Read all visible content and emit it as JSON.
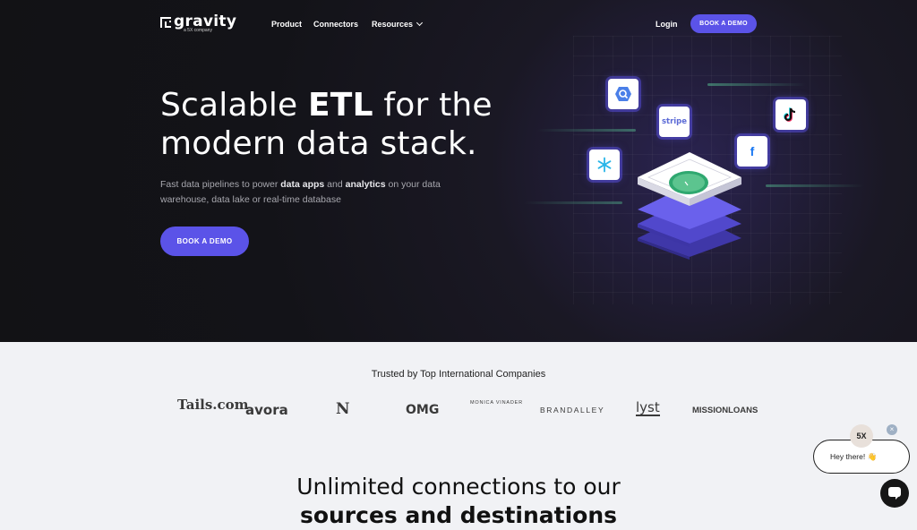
{
  "nav": {
    "logo_text": "gravity",
    "logo_sub": "a 5X company",
    "links": [
      "Product",
      "Connectors",
      "Resources"
    ],
    "login": "Login",
    "cta": "BOOK A DEMO"
  },
  "hero": {
    "headline_pre": "Scalable ",
    "headline_bold": "ETL",
    "headline_post": " for the",
    "headline_line2": "modern data stack.",
    "sub_1": "Fast data pipelines to power ",
    "sub_b1": "data apps",
    "sub_2": " and ",
    "sub_b2": "analytics",
    "sub_3": " on your data warehouse, data lake or real-time database",
    "cta": "BOOK A DEMO",
    "integrations": [
      "bigquery-icon",
      "stripe",
      "tiktok-icon",
      "snowflake-icon",
      "facebook-icon"
    ],
    "stripe_label": "stripe",
    "facebook_label": "f",
    "accent": "#5b53e8"
  },
  "trusted": {
    "title": "Trusted by Top International Companies",
    "brands": [
      "Tails.com",
      "avora",
      "N",
      "OMG",
      "MONICA VINADER",
      "BRANDALLEY",
      "lyst",
      "MISSIONLOANS"
    ]
  },
  "section": {
    "line1": "Unlimited connections to our",
    "line2": "sources and destinations"
  },
  "chat": {
    "avatar": "5X",
    "close": "×",
    "message": "Hey there! 👋"
  }
}
